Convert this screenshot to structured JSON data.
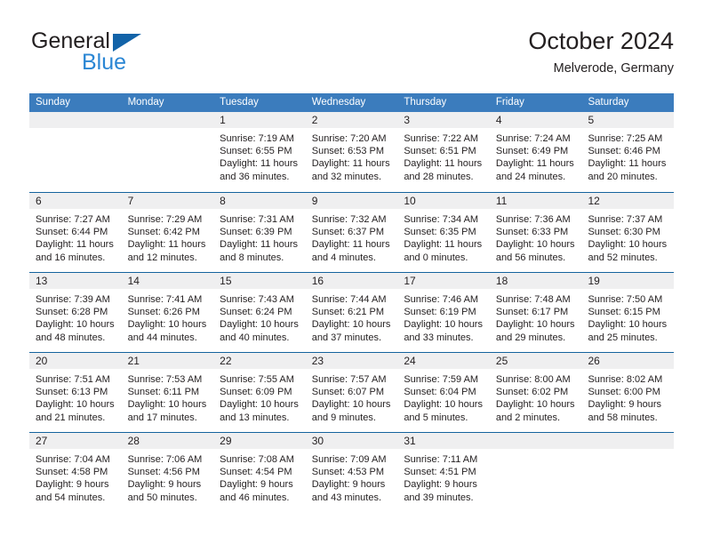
{
  "brand": {
    "word_one": "General",
    "word_two": "Blue",
    "triangle_color": "#1263a8",
    "blue_color": "#2a86d4"
  },
  "header": {
    "title": "October 2024",
    "location": "Melverode, Germany"
  },
  "theme": {
    "header_blue": "#3b7cbd",
    "rule_blue": "#15639e",
    "daynum_band": "#efeff0",
    "text": "#231f20"
  },
  "weekday_headers": [
    "Sunday",
    "Monday",
    "Tuesday",
    "Wednesday",
    "Thursday",
    "Friday",
    "Saturday"
  ],
  "labels": {
    "sunrise": "Sunrise:",
    "sunset": "Sunset:",
    "daylight": "Daylight:"
  },
  "weeks": [
    [
      {
        "day": "",
        "sunrise": "",
        "sunset": "",
        "daylight_1": "",
        "daylight_2": ""
      },
      {
        "day": "",
        "sunrise": "",
        "sunset": "",
        "daylight_1": "",
        "daylight_2": ""
      },
      {
        "day": "1",
        "sunrise": "Sunrise: 7:19 AM",
        "sunset": "Sunset: 6:55 PM",
        "daylight_1": "Daylight: 11 hours",
        "daylight_2": "and 36 minutes."
      },
      {
        "day": "2",
        "sunrise": "Sunrise: 7:20 AM",
        "sunset": "Sunset: 6:53 PM",
        "daylight_1": "Daylight: 11 hours",
        "daylight_2": "and 32 minutes."
      },
      {
        "day": "3",
        "sunrise": "Sunrise: 7:22 AM",
        "sunset": "Sunset: 6:51 PM",
        "daylight_1": "Daylight: 11 hours",
        "daylight_2": "and 28 minutes."
      },
      {
        "day": "4",
        "sunrise": "Sunrise: 7:24 AM",
        "sunset": "Sunset: 6:49 PM",
        "daylight_1": "Daylight: 11 hours",
        "daylight_2": "and 24 minutes."
      },
      {
        "day": "5",
        "sunrise": "Sunrise: 7:25 AM",
        "sunset": "Sunset: 6:46 PM",
        "daylight_1": "Daylight: 11 hours",
        "daylight_2": "and 20 minutes."
      }
    ],
    [
      {
        "day": "6",
        "sunrise": "Sunrise: 7:27 AM",
        "sunset": "Sunset: 6:44 PM",
        "daylight_1": "Daylight: 11 hours",
        "daylight_2": "and 16 minutes."
      },
      {
        "day": "7",
        "sunrise": "Sunrise: 7:29 AM",
        "sunset": "Sunset: 6:42 PM",
        "daylight_1": "Daylight: 11 hours",
        "daylight_2": "and 12 minutes."
      },
      {
        "day": "8",
        "sunrise": "Sunrise: 7:31 AM",
        "sunset": "Sunset: 6:39 PM",
        "daylight_1": "Daylight: 11 hours",
        "daylight_2": "and 8 minutes."
      },
      {
        "day": "9",
        "sunrise": "Sunrise: 7:32 AM",
        "sunset": "Sunset: 6:37 PM",
        "daylight_1": "Daylight: 11 hours",
        "daylight_2": "and 4 minutes."
      },
      {
        "day": "10",
        "sunrise": "Sunrise: 7:34 AM",
        "sunset": "Sunset: 6:35 PM",
        "daylight_1": "Daylight: 11 hours",
        "daylight_2": "and 0 minutes."
      },
      {
        "day": "11",
        "sunrise": "Sunrise: 7:36 AM",
        "sunset": "Sunset: 6:33 PM",
        "daylight_1": "Daylight: 10 hours",
        "daylight_2": "and 56 minutes."
      },
      {
        "day": "12",
        "sunrise": "Sunrise: 7:37 AM",
        "sunset": "Sunset: 6:30 PM",
        "daylight_1": "Daylight: 10 hours",
        "daylight_2": "and 52 minutes."
      }
    ],
    [
      {
        "day": "13",
        "sunrise": "Sunrise: 7:39 AM",
        "sunset": "Sunset: 6:28 PM",
        "daylight_1": "Daylight: 10 hours",
        "daylight_2": "and 48 minutes."
      },
      {
        "day": "14",
        "sunrise": "Sunrise: 7:41 AM",
        "sunset": "Sunset: 6:26 PM",
        "daylight_1": "Daylight: 10 hours",
        "daylight_2": "and 44 minutes."
      },
      {
        "day": "15",
        "sunrise": "Sunrise: 7:43 AM",
        "sunset": "Sunset: 6:24 PM",
        "daylight_1": "Daylight: 10 hours",
        "daylight_2": "and 40 minutes."
      },
      {
        "day": "16",
        "sunrise": "Sunrise: 7:44 AM",
        "sunset": "Sunset: 6:21 PM",
        "daylight_1": "Daylight: 10 hours",
        "daylight_2": "and 37 minutes."
      },
      {
        "day": "17",
        "sunrise": "Sunrise: 7:46 AM",
        "sunset": "Sunset: 6:19 PM",
        "daylight_1": "Daylight: 10 hours",
        "daylight_2": "and 33 minutes."
      },
      {
        "day": "18",
        "sunrise": "Sunrise: 7:48 AM",
        "sunset": "Sunset: 6:17 PM",
        "daylight_1": "Daylight: 10 hours",
        "daylight_2": "and 29 minutes."
      },
      {
        "day": "19",
        "sunrise": "Sunrise: 7:50 AM",
        "sunset": "Sunset: 6:15 PM",
        "daylight_1": "Daylight: 10 hours",
        "daylight_2": "and 25 minutes."
      }
    ],
    [
      {
        "day": "20",
        "sunrise": "Sunrise: 7:51 AM",
        "sunset": "Sunset: 6:13 PM",
        "daylight_1": "Daylight: 10 hours",
        "daylight_2": "and 21 minutes."
      },
      {
        "day": "21",
        "sunrise": "Sunrise: 7:53 AM",
        "sunset": "Sunset: 6:11 PM",
        "daylight_1": "Daylight: 10 hours",
        "daylight_2": "and 17 minutes."
      },
      {
        "day": "22",
        "sunrise": "Sunrise: 7:55 AM",
        "sunset": "Sunset: 6:09 PM",
        "daylight_1": "Daylight: 10 hours",
        "daylight_2": "and 13 minutes."
      },
      {
        "day": "23",
        "sunrise": "Sunrise: 7:57 AM",
        "sunset": "Sunset: 6:07 PM",
        "daylight_1": "Daylight: 10 hours",
        "daylight_2": "and 9 minutes."
      },
      {
        "day": "24",
        "sunrise": "Sunrise: 7:59 AM",
        "sunset": "Sunset: 6:04 PM",
        "daylight_1": "Daylight: 10 hours",
        "daylight_2": "and 5 minutes."
      },
      {
        "day": "25",
        "sunrise": "Sunrise: 8:00 AM",
        "sunset": "Sunset: 6:02 PM",
        "daylight_1": "Daylight: 10 hours",
        "daylight_2": "and 2 minutes."
      },
      {
        "day": "26",
        "sunrise": "Sunrise: 8:02 AM",
        "sunset": "Sunset: 6:00 PM",
        "daylight_1": "Daylight: 9 hours",
        "daylight_2": "and 58 minutes."
      }
    ],
    [
      {
        "day": "27",
        "sunrise": "Sunrise: 7:04 AM",
        "sunset": "Sunset: 4:58 PM",
        "daylight_1": "Daylight: 9 hours",
        "daylight_2": "and 54 minutes."
      },
      {
        "day": "28",
        "sunrise": "Sunrise: 7:06 AM",
        "sunset": "Sunset: 4:56 PM",
        "daylight_1": "Daylight: 9 hours",
        "daylight_2": "and 50 minutes."
      },
      {
        "day": "29",
        "sunrise": "Sunrise: 7:08 AM",
        "sunset": "Sunset: 4:54 PM",
        "daylight_1": "Daylight: 9 hours",
        "daylight_2": "and 46 minutes."
      },
      {
        "day": "30",
        "sunrise": "Sunrise: 7:09 AM",
        "sunset": "Sunset: 4:53 PM",
        "daylight_1": "Daylight: 9 hours",
        "daylight_2": "and 43 minutes."
      },
      {
        "day": "31",
        "sunrise": "Sunrise: 7:11 AM",
        "sunset": "Sunset: 4:51 PM",
        "daylight_1": "Daylight: 9 hours",
        "daylight_2": "and 39 minutes."
      },
      {
        "day": "",
        "sunrise": "",
        "sunset": "",
        "daylight_1": "",
        "daylight_2": ""
      },
      {
        "day": "",
        "sunrise": "",
        "sunset": "",
        "daylight_1": "",
        "daylight_2": ""
      }
    ]
  ]
}
